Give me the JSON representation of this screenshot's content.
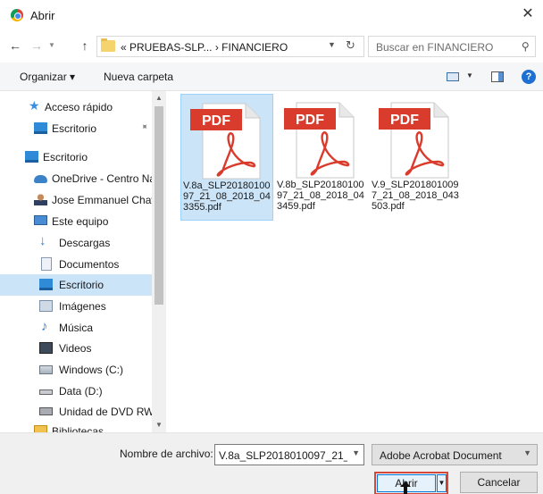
{
  "window": {
    "title": "Abrir",
    "close_glyph": "✕"
  },
  "nav": {
    "back_glyph": "←",
    "forward_glyph": "→",
    "dropdown_glyph": "▼",
    "up_glyph": "↑",
    "breadcrumb": "« PRUEBAS-SLP...  ›  FINANCIERO",
    "address_dropdown_glyph": "▼",
    "refresh_glyph": "↻",
    "search_placeholder": "Buscar en FINANCIERO",
    "search_glyph": "⚲"
  },
  "toolbar": {
    "organize_label": "Organizar ▾",
    "new_folder_label": "Nueva carpeta",
    "view_dropdown_glyph": "▼",
    "help_glyph": "?"
  },
  "sidebar": {
    "items": [
      {
        "label": "Acceso rápido",
        "icon": "star-icon"
      },
      {
        "label": "Escritorio",
        "icon": "desktop-icon",
        "pinned": true
      },
      {
        "label": "Escritorio",
        "icon": "desktop-icon"
      },
      {
        "label": "OneDrive - Centro Na",
        "icon": "onedrive-icon"
      },
      {
        "label": "Jose Emmanuel Chave",
        "icon": "user-icon"
      },
      {
        "label": "Este equipo",
        "icon": "pc-icon"
      },
      {
        "label": "Descargas",
        "icon": "downloads-icon"
      },
      {
        "label": "Documentos",
        "icon": "documents-icon"
      },
      {
        "label": "Escritorio",
        "icon": "desktop-icon",
        "selected": true
      },
      {
        "label": "Imágenes",
        "icon": "pictures-icon"
      },
      {
        "label": "Música",
        "icon": "music-icon"
      },
      {
        "label": "Videos",
        "icon": "videos-icon"
      },
      {
        "label": "Windows (C:)",
        "icon": "drive-c-icon"
      },
      {
        "label": "Data (D:)",
        "icon": "drive-d-icon"
      },
      {
        "label": "Unidad de DVD RW (",
        "icon": "dvd-icon"
      },
      {
        "label": "Bibliotecas",
        "icon": "libraries-icon"
      }
    ],
    "pin_glyph": "📌",
    "scroll_up_glyph": "▲",
    "scroll_down_glyph": "▼"
  },
  "files": [
    {
      "name": "V.8a_SLP2018010097_21_08_2018_043355.pdf",
      "badge": "PDF",
      "selected": true
    },
    {
      "name": "V.8b_SLP2018010097_21_08_2018_043459.pdf",
      "badge": "PDF",
      "selected": false
    },
    {
      "name": "V.9_SLP2018010097_21_08_2018_043503.pdf",
      "badge": "PDF",
      "selected": false
    }
  ],
  "footer": {
    "filename_label": "Nombre de archivo:",
    "filename_value": "V.8a_SLP2018010097_21_08_",
    "filename_dropdown_glyph": "▼",
    "filetype_value": "Adobe Acrobat Document",
    "filetype_dropdown_glyph": "▼",
    "open_label": "Abrir",
    "open_split_glyph": "▼",
    "cancel_label": "Cancelar"
  },
  "colors": {
    "pdf_badge": "#d93b2c",
    "selection": "#cce4f7",
    "accent": "#0078d7",
    "highlight_border": "#d4483a"
  }
}
